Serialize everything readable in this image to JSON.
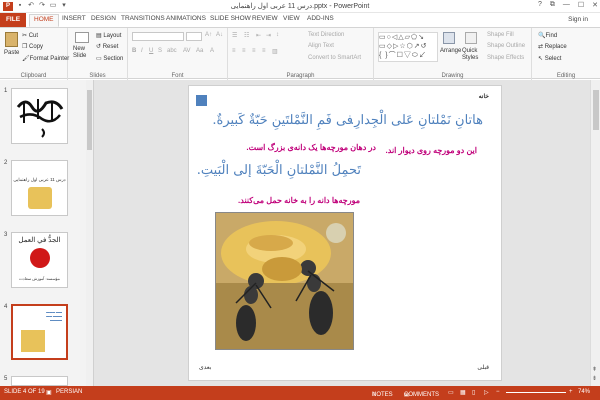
{
  "window": {
    "title": "درس 11 عربی اول راهنمایی.pptx - PowerPoint",
    "app_icon": "P",
    "controls": [
      "?",
      "⧉",
      "—",
      "☐",
      "✕"
    ]
  },
  "tabs": [
    "FILE",
    "HOME",
    "INSERT",
    "DESIGN",
    "TRANSITIONS",
    "ANIMATIONS",
    "SLIDE SHOW",
    "REVIEW",
    "VIEW",
    "ADD-INS"
  ],
  "signin": "Sign in",
  "ribbon": {
    "clipboard": {
      "paste": "Paste",
      "cut": "Cut",
      "copy": "Copy",
      "format_painter": "Format Painter",
      "label": "Clipboard"
    },
    "slides": {
      "new_slide": "New Slide",
      "layout": "Layout",
      "reset": "Reset",
      "section": "Section",
      "label": "Slides"
    },
    "font": {
      "label": "Font"
    },
    "paragraph": {
      "text_direction": "Text Direction",
      "align_text": "Align Text",
      "convert_smartart": "Convert to SmartArt",
      "label": "Paragraph"
    },
    "drawing": {
      "arrange": "Arrange",
      "quick_styles": "Quick Styles",
      "shape_fill": "Shape Fill",
      "shape_outline": "Shape Outline",
      "shape_effects": "Shape Effects",
      "label": "Drawing"
    },
    "editing": {
      "find": "Find",
      "replace": "Replace",
      "select": "Select",
      "label": "Editing"
    }
  },
  "thumbnails": {
    "numbers": [
      "1",
      "2",
      "3",
      "4",
      "5"
    ],
    "slide2_title": "درس 11 عربی اول راهنمایی",
    "slide3_title": "الجدُّ في العمل",
    "slide3_sub": "مؤسسه: آموزش سعادت"
  },
  "slide": {
    "header": "خانه",
    "line1_right": "هاتانِ نَمْلتانِ عَلى الْجِدارِ.",
    "line1_left": "فی فَمِ النَّمْلتَینِ حَبّةٌ کَبیرةٌ.",
    "trans1_right": "این دو مورچه روی دیوار اند.",
    "trans1_left": "در دهان مورچه‌ها یک دانه‌ی بزرگ است.",
    "line2": "تَحمِلُ النَّمْلتانِ الْحَبّةَ إلی الْبَیتِ.",
    "trans2": "مورچه‌ها دانه را به خانه حمل می‌کنند.",
    "next": "بعدی",
    "prev": "قبلی"
  },
  "status": {
    "slide_of": "SLIDE 4 OF 19",
    "language": "PERSIAN",
    "notes": "NOTES",
    "comments": "COMMENTS",
    "zoom": "74%"
  },
  "colors": {
    "accent": "#c43e1c",
    "arabic_text": "#4f81bd",
    "persian_text": "#c0007a"
  }
}
